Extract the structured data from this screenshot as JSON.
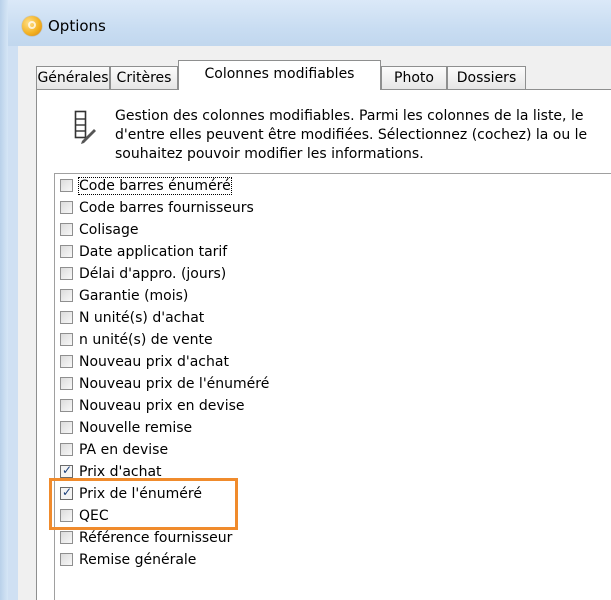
{
  "window": {
    "title": "Options"
  },
  "tabs": [
    {
      "label": "Générales",
      "active": false
    },
    {
      "label": "Critères",
      "active": false
    },
    {
      "label": "Colonnes modifiables",
      "active": true
    },
    {
      "label": "Photo",
      "active": false
    },
    {
      "label": "Dossiers",
      "active": false
    }
  ],
  "description": {
    "icon": "edit-columns-icon",
    "line1": "Gestion des colonnes modifiables. Parmi les colonnes de la liste, le",
    "line2": "d'entre elles peuvent être modifiées. Sélectionnez (cochez) la ou le",
    "line3": "souhaitez pouvoir modifier les informations."
  },
  "columns": [
    {
      "label": "Code barres énuméré",
      "checked": false
    },
    {
      "label": "Code barres fournisseurs",
      "checked": false
    },
    {
      "label": "Colisage",
      "checked": false
    },
    {
      "label": "Date application tarif",
      "checked": false
    },
    {
      "label": "Délai d'appro. (jours)",
      "checked": false
    },
    {
      "label": "Garantie (mois)",
      "checked": false
    },
    {
      "label": "N unité(s) d'achat",
      "checked": false
    },
    {
      "label": "n unité(s) de vente",
      "checked": false
    },
    {
      "label": "Nouveau prix d'achat",
      "checked": false
    },
    {
      "label": "Nouveau prix de l'énuméré",
      "checked": false
    },
    {
      "label": "Nouveau prix en devise",
      "checked": false
    },
    {
      "label": "Nouvelle remise",
      "checked": false
    },
    {
      "label": "PA en devise",
      "checked": false
    },
    {
      "label": "Prix d'achat",
      "checked": true
    },
    {
      "label": "Prix de l'énuméré",
      "checked": true
    },
    {
      "label": "QEC",
      "checked": false
    },
    {
      "label": "Référence fournisseur",
      "checked": false
    },
    {
      "label": "Remise générale",
      "checked": false
    }
  ],
  "colors": {
    "highlight": "#f08b2c",
    "check": "#1b3f7a"
  }
}
